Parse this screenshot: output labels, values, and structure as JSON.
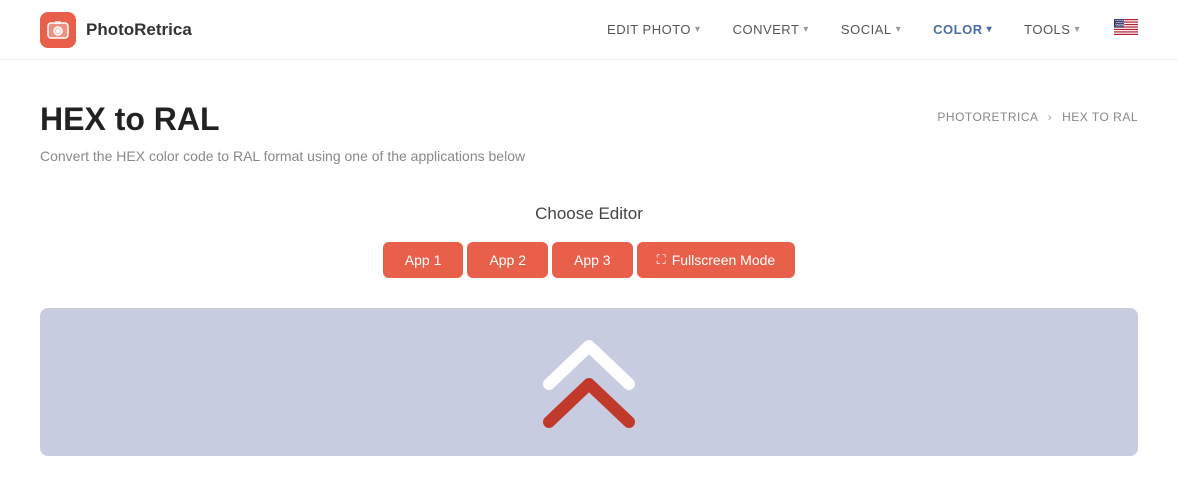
{
  "logo": {
    "name": "PhotoRetrica"
  },
  "nav": {
    "items": [
      {
        "id": "edit-photo",
        "label": "EDIT PHOTO",
        "active": false
      },
      {
        "id": "convert",
        "label": "CONVERT",
        "active": false
      },
      {
        "id": "social",
        "label": "SOCIAL",
        "active": false
      },
      {
        "id": "color",
        "label": "COLOR",
        "active": true
      },
      {
        "id": "tools",
        "label": "TOOLS",
        "active": false
      }
    ]
  },
  "page": {
    "title": "HEX to RAL",
    "description": "Convert the HEX color code to RAL format using one of the applications below"
  },
  "breadcrumb": {
    "home": "PHOTORETRICA",
    "separator": "›",
    "current": "HEX TO RAL"
  },
  "editor_section": {
    "title": "Choose Editor",
    "buttons": [
      {
        "id": "app1",
        "label": "App 1"
      },
      {
        "id": "app2",
        "label": "App 2"
      },
      {
        "id": "app3",
        "label": "App 3"
      },
      {
        "id": "fullscreen",
        "label": "Fullscreen Mode"
      }
    ]
  },
  "colors": {
    "brand": "#e8604a",
    "nav_active": "#4a6fa5",
    "loader_bg": "#c8cce0"
  }
}
